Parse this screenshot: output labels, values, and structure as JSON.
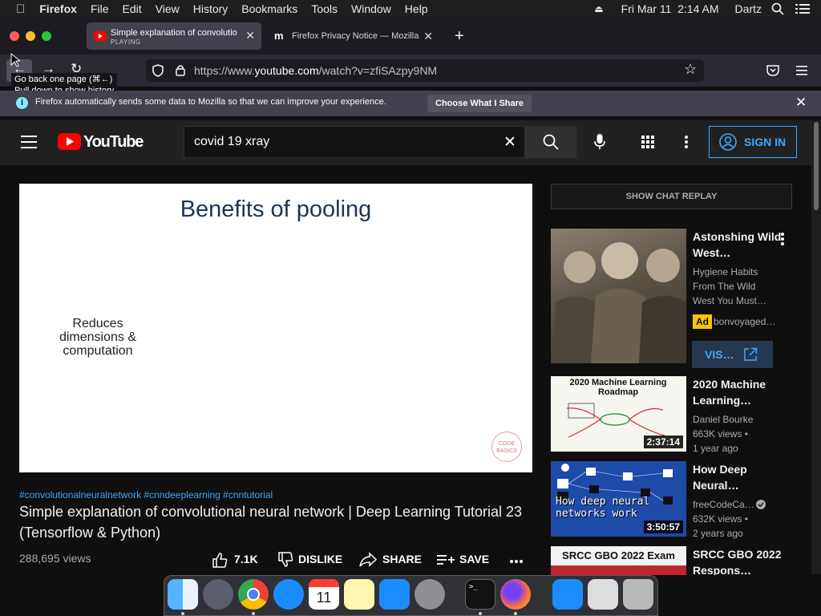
{
  "menubar": {
    "apple": "",
    "app": "Firefox",
    "items": [
      "File",
      "Edit",
      "View",
      "History",
      "Bookmarks",
      "Tools",
      "Window",
      "Help"
    ],
    "datetime": "Fri Mar 11  2:14 AM",
    "user": "Dartz"
  },
  "tabs": [
    {
      "title": "Simple explanation of convolutio",
      "status": "PLAYING"
    },
    {
      "title": "Firefox Privacy Notice — Mozilla"
    }
  ],
  "nav": {
    "url_prefix": "https://www.",
    "url_domain": "youtube.com",
    "url_path": "/watch?v=zfiSAzpy9NM",
    "tooltip_line1": "Go back one page (⌘←)",
    "tooltip_line2": "Pull down to show history"
  },
  "notification": {
    "text": "Firefox automatically sends some data to Mozilla so that we can improve your experience.",
    "button": "Choose What I Share"
  },
  "youtube": {
    "logo": "YouTube",
    "search_value": "covid 19 xray",
    "signin": "SIGN IN",
    "chat_replay": "SHOW CHAT REPLAY"
  },
  "video": {
    "slide_title": "Benefits of pooling",
    "slide_text": "Reduces dimensions & computation",
    "watermark": "CODE BASICS",
    "hashtags": "#convolutionalneuralnetwork #cnndeeplearning #cnntutorial",
    "title": "Simple explanation of convolutional neural network | Deep Learning Tutorial 23 (Tensorflow & Python)",
    "views": "288,695 views",
    "likes": "7.1K",
    "dislike": "DISLIKE",
    "share": "SHARE",
    "save": "SAVE"
  },
  "sidebar": [
    {
      "title": "Astonshing Wild West…",
      "channel": "Hygiene Habits From The Wild West You Must…",
      "ad": "Ad",
      "advertiser": "bonvoyaged…",
      "visit": "VIS…"
    },
    {
      "title": "2020 Machine Learning…",
      "channel": "Daniel Bourke",
      "views": "663K views •",
      "age": "1 year ago",
      "duration": "2:37:14",
      "thumb_title": "2020 Machine Learning Roadmap"
    },
    {
      "title": "How Deep Neural…",
      "channel": "freeCodeCa…",
      "views": "632K views •",
      "age": "2 years ago",
      "duration": "3:50:57",
      "thumb_text": "How deep neural networks work"
    },
    {
      "title": "SRCC GBO 2022 Respons…",
      "thumb_title": "SRCC GBO 2022 Exam"
    }
  ],
  "colors": {
    "accent_blue": "#3ea6ff",
    "youtube_red": "#ff0000",
    "ad_yellow": "#f9c500"
  }
}
